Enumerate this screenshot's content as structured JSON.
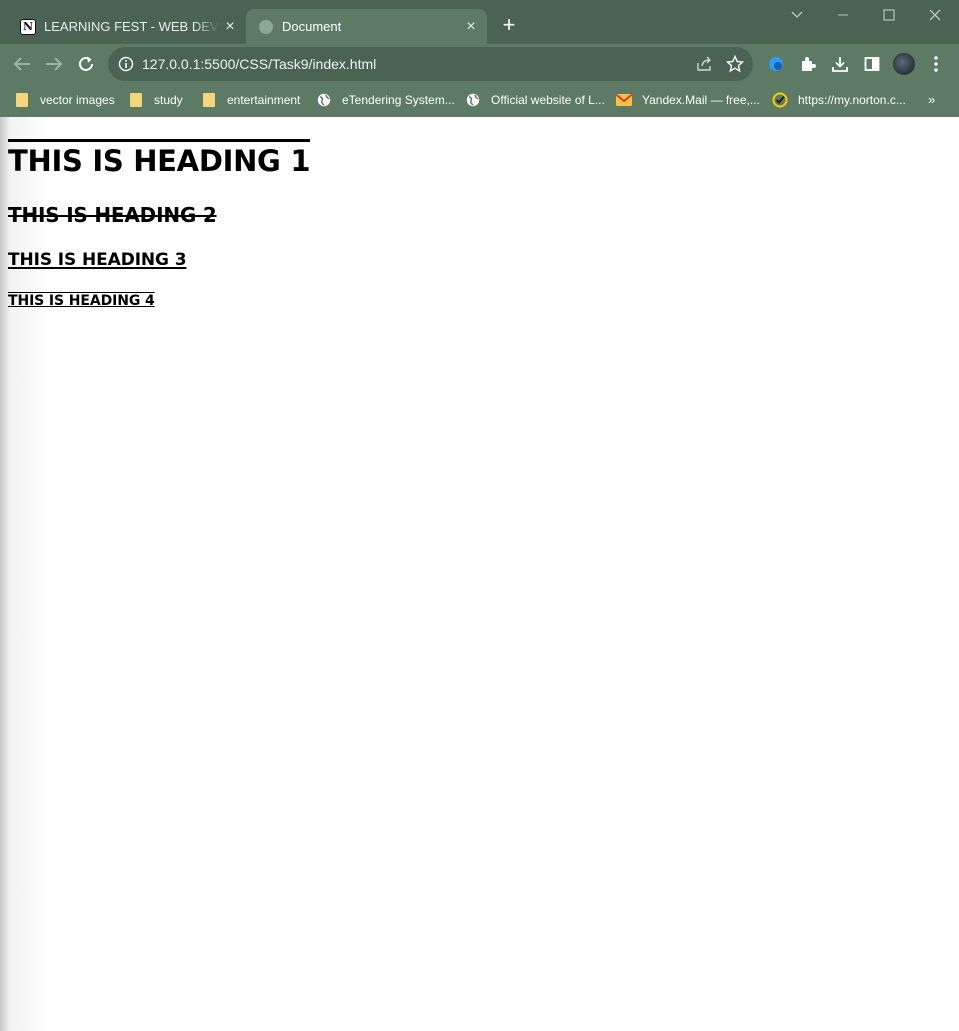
{
  "browser": {
    "tabs": [
      {
        "title": "LEARNING FEST - WEB DEVELOP",
        "icon": "notion-icon",
        "close": "×"
      },
      {
        "title": "Document",
        "icon": "globe-icon",
        "close": "×"
      }
    ],
    "new_tab": "+",
    "address": "127.0.0.1:5500/CSS/Task9/index.html",
    "bookmarks": [
      {
        "label": "vector images",
        "icon": "folder-icon"
      },
      {
        "label": "study",
        "icon": "folder-icon"
      },
      {
        "label": "entertainment",
        "icon": "folder-icon"
      },
      {
        "label": "eTendering System...",
        "icon": "globe-icon"
      },
      {
        "label": "Official website of L...",
        "icon": "globe-icon"
      },
      {
        "label": "Yandex.Mail — free,...",
        "icon": "mail-icon"
      },
      {
        "label": "https://my.norton.c...",
        "icon": "norton-icon"
      }
    ],
    "bookmarks_more": "»",
    "colors": {
      "frame": "#4a6352",
      "toolbar": "#5d7a64"
    }
  },
  "page": {
    "heading1": "THIS IS HEADING 1",
    "heading2": "THIS IS HEADING 2",
    "heading3": "THIS IS HEADING 3",
    "heading4": "THIS IS HEADING 4"
  }
}
